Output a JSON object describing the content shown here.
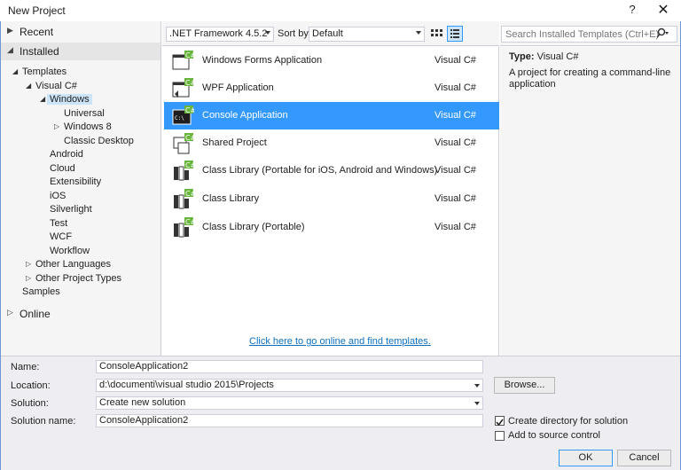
{
  "window": {
    "title": "New Project",
    "help": "?",
    "close": "✕"
  },
  "nav": {
    "recent": "Recent",
    "installed": "Installed",
    "online": "Online",
    "tree": {
      "templates": "Templates",
      "visual_csharp": "Visual C#",
      "windows": "Windows",
      "universal": "Universal",
      "windows8": "Windows 8",
      "classic_desktop": "Classic Desktop",
      "android": "Android",
      "cloud": "Cloud",
      "extensibility": "Extensibility",
      "ios": "iOS",
      "silverlight": "Silverlight",
      "test": "Test",
      "wcf": "WCF",
      "workflow": "Workflow",
      "other_languages": "Other Languages",
      "other_project_types": "Other Project Types",
      "samples": "Samples"
    }
  },
  "toolbar": {
    "framework": ".NET Framework 4.5.2",
    "sort_label": "Sort by:",
    "sort_value": "Default"
  },
  "search": {
    "placeholder": "Search Installed Templates (Ctrl+E)"
  },
  "templates": [
    {
      "name": "Windows Forms Application",
      "lang": "Visual C#"
    },
    {
      "name": "WPF Application",
      "lang": "Visual C#"
    },
    {
      "name": "Console Application",
      "lang": "Visual C#"
    },
    {
      "name": "Shared Project",
      "lang": "Visual C#"
    },
    {
      "name": "Class Library (Portable for iOS, Android and Windows)",
      "lang": "Visual C#"
    },
    {
      "name": "Class Library",
      "lang": "Visual C#"
    },
    {
      "name": "Class Library (Portable)",
      "lang": "Visual C#"
    }
  ],
  "online_link": "Click here to go online and find templates.",
  "description": {
    "type_label": "Type:",
    "type_value": "Visual C#",
    "text": "A project for creating a command-line application"
  },
  "form": {
    "name_label": "Name:",
    "name_value": "ConsoleApplication2",
    "location_label": "Location:",
    "location_value": "d:\\documenti\\visual studio 2015\\Projects",
    "solution_label": "Solution:",
    "solution_value": "Create new solution",
    "solution_name_label": "Solution name:",
    "solution_name_value": "ConsoleApplication2",
    "browse": "Browse...",
    "create_dir": "Create directory for solution",
    "add_source": "Add to source control",
    "ok": "OK",
    "cancel": "Cancel"
  },
  "colors": {
    "accent": "#3399ff",
    "link": "#0e70c0",
    "csharp_green": "#68b53b"
  }
}
